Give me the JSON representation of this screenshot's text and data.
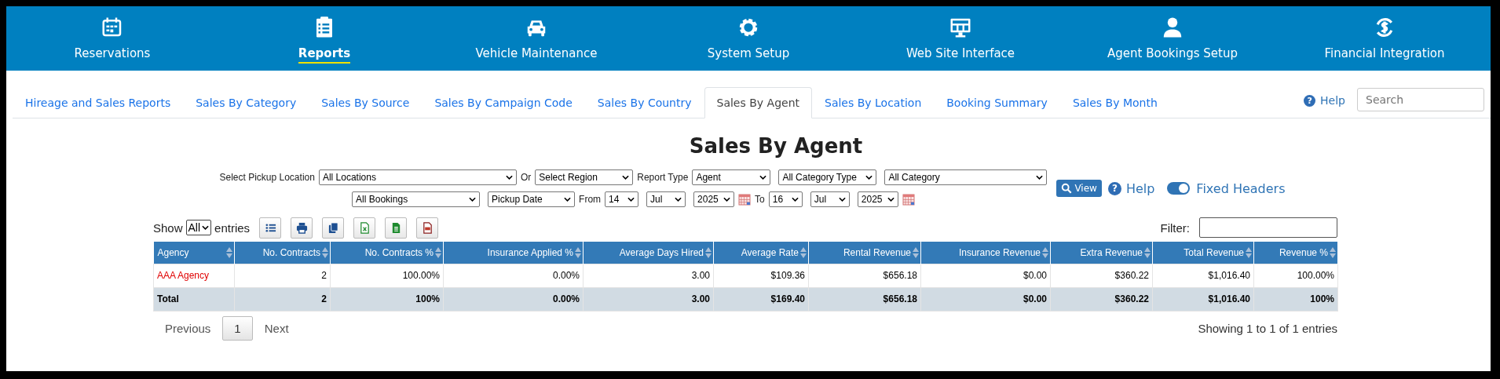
{
  "nav": [
    {
      "label": "Reservations",
      "selected": false
    },
    {
      "label": "Reports",
      "selected": true
    },
    {
      "label": "Vehicle Maintenance",
      "selected": false
    },
    {
      "label": "System Setup",
      "selected": false
    },
    {
      "label": "Web Site Interface",
      "selected": false
    },
    {
      "label": "Agent Bookings Setup",
      "selected": false
    },
    {
      "label": "Financial Integration",
      "selected": false
    }
  ],
  "tabs": [
    {
      "label": "Hireage and Sales Reports",
      "selected": false
    },
    {
      "label": "Sales By Category",
      "selected": false
    },
    {
      "label": "Sales By Source",
      "selected": false
    },
    {
      "label": "Sales By Campaign Code",
      "selected": false
    },
    {
      "label": "Sales By Country",
      "selected": false
    },
    {
      "label": "Sales By Agent",
      "selected": true
    },
    {
      "label": "Sales By Location",
      "selected": false
    },
    {
      "label": "Booking Summary",
      "selected": false
    },
    {
      "label": "Sales By Month",
      "selected": false
    }
  ],
  "help_icon": "?",
  "tabs_help": "Help",
  "search": {
    "placeholder": "Search"
  },
  "title": "Sales By Agent",
  "filters": {
    "line_1": [
      {
        "kind": "label",
        "text": "Select Pickup Location"
      },
      {
        "kind": "select",
        "value": "All Locations"
      },
      {
        "kind": "label",
        "text": "Or"
      },
      {
        "kind": "select",
        "value": "Select Region"
      },
      {
        "kind": "label",
        "text": "Report Type"
      },
      {
        "kind": "select",
        "value": "Agent"
      },
      {
        "kind": "select",
        "value": "All Category Type"
      },
      {
        "kind": "select",
        "value": "All Category"
      }
    ],
    "line_2": [
      {
        "kind": "select",
        "value": "All Bookings"
      },
      {
        "kind": "select",
        "value": "Pickup Date"
      },
      {
        "kind": "label",
        "text": "From"
      },
      {
        "kind": "select",
        "value": "14"
      },
      {
        "kind": "select",
        "value": "Jul"
      },
      {
        "kind": "select",
        "value": "2025"
      },
      {
        "kind": "calendar"
      },
      {
        "kind": "label",
        "text": "To"
      },
      {
        "kind": "select",
        "value": "16"
      },
      {
        "kind": "select",
        "value": "Jul"
      },
      {
        "kind": "select",
        "value": "2025"
      },
      {
        "kind": "calendar"
      }
    ],
    "view_button": "View",
    "help": "Help",
    "fixed_headers": {
      "label": "Fixed Headers",
      "on": true
    }
  },
  "table_tools": {
    "show": "Show",
    "page_size": "All",
    "entries": "entries",
    "filter_label": "Filter:"
  },
  "table": {
    "columns": [
      "Agency",
      "No. Contracts",
      "No. Contracts %",
      "Insurance Applied %",
      "Average Days Hired",
      "Average Rate",
      "Rental Revenue",
      "Insurance Revenue",
      "Extra Revenue",
      "Total Revenue",
      "Revenue %"
    ],
    "rows": [
      [
        "AAA Agency",
        "2",
        "100.00%",
        "0.00%",
        "3.00",
        "$109.36",
        "$656.18",
        "$0.00",
        "$360.22",
        "$1,016.40",
        "100.00%"
      ]
    ],
    "total": [
      "Total",
      "2",
      "100%",
      "0.00%",
      "3.00",
      "$169.40",
      "$656.18",
      "$0.00",
      "$360.22",
      "$1,016.40",
      "100%"
    ]
  },
  "pagination": {
    "previous": "Previous",
    "pages": [
      {
        "label": "1",
        "selected": true
      }
    ],
    "next": "Next"
  },
  "info": "Showing 1 to 1 of 1 entries"
}
